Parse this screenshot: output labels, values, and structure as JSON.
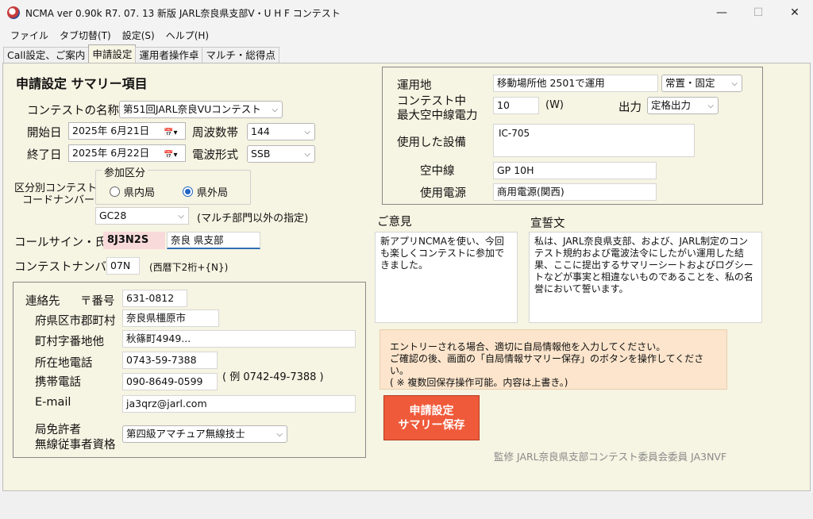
{
  "window": {
    "title": "NCMA ver 0.90k R7. 07. 13 新版 JARL奈良県支部V・U H F コンテスト",
    "minimize": "—",
    "maximize": "☐",
    "close": "✕"
  },
  "menu": [
    "ファイル",
    "タブ切替(T)",
    "設定(S)",
    "ヘルプ(H)"
  ],
  "tabs": [
    {
      "label": "Call設定、ご案内"
    },
    {
      "label": "申請設定"
    },
    {
      "label": "運用者操作卓"
    },
    {
      "label": "マルチ・総得点"
    }
  ],
  "summary": {
    "heading": "申請設定 サマリー項目",
    "contest_name_label": "コンテストの名称",
    "contest_name": "第51回JARL奈良VUコンテスト",
    "start_label": "開始日",
    "start_date": "2025年 6月21日",
    "end_label": "終了日",
    "end_date": "2025年 6月22日",
    "band_label": "周波数帯",
    "band": "144",
    "mode_label": "電波形式",
    "mode": "SSB",
    "category_label_line1": "区分別コンテスト",
    "category_label_line2": "コードナンバー",
    "participation_title": "参加区分",
    "radio_in": "県内局",
    "radio_out": "県外局",
    "category_code": "GC28",
    "category_note": "(マルチ部門以外の指定)",
    "callsign_label": "コールサイン・氏名",
    "callsign": "8J3N2S",
    "name": "奈良 県支部",
    "contest_number_label": "コンテストナンバー",
    "contest_number": "07N",
    "contest_number_note": "(西暦下2桁+{N})"
  },
  "contact": {
    "title": "連絡先",
    "postal_label": "〒番号",
    "postal": "631-0812",
    "pref_label": "府県区市郡町村",
    "pref": "奈良県橿原市",
    "town_label": "町村字番地他",
    "town": "秋篠町4949...",
    "office_phone_label": "所在地電話",
    "office_phone": "0743-59-7388",
    "mobile_label": "携帯電話",
    "mobile": "090-8649-0599",
    "phone_example": "( 例 0742-49-7388 )",
    "email_label": "E-mail",
    "email": "ja3qrz@jarl.com",
    "license_label_line1": "局免許者",
    "license_label_line2": "無線従事者資格",
    "license": "第四級アマチュア無線技士"
  },
  "operation": {
    "location_label": "運用地",
    "location": "移動場所他 2501で運用",
    "location_type": "常置・固定",
    "power_label_line1": "コンテスト中",
    "power_label_line2": "最大空中線電力",
    "power": "10",
    "power_unit": "(W)",
    "output_label": "出力",
    "output": "定格出力",
    "equipment_label": "使用した設備",
    "equipment": "IC-705",
    "antenna_label": "空中線",
    "antenna": "GP 10H",
    "power_source_label": "使用電源",
    "power_source": "商用電源(関西)"
  },
  "opinion": {
    "label": "ご意見",
    "text": "新アプリNCMAを使い、今回も楽しくコンテストに参加できました。"
  },
  "oath": {
    "label": "宣誓文",
    "text": "私は、JARL奈良県支部、および、JARL制定のコンテスト規約および電波法令にしたがい運用した結果、ここに提出するサマリーシートおよびログシートなどが事実と相違ないものであることを、私の名誉において誓います。"
  },
  "notice": {
    "line1": "エントリーされる場合、適切に自局情報他を入力してください。",
    "line2": "ご確認の後、画面の「自局情報サマリー保存」のボタンを操作してください。",
    "line3": "( ※ 複数回保存操作可能。内容は上書き。)"
  },
  "save_button": {
    "line1": "申請設定",
    "line2": "サマリー保存"
  },
  "supervisor": "監修 JARL奈良県支部コンテスト委員会委員 JA3NVF",
  "colors": {
    "panel_bg": "#f6f4e2",
    "save_button": "#ef5a3a",
    "notice_bg": "#fce5cc",
    "callsign_bg": "#f9dada",
    "radio_accent": "#1f63c4"
  },
  "icons": {
    "calendar": "calendar-icon",
    "dropdown": "chevron-down-icon"
  }
}
